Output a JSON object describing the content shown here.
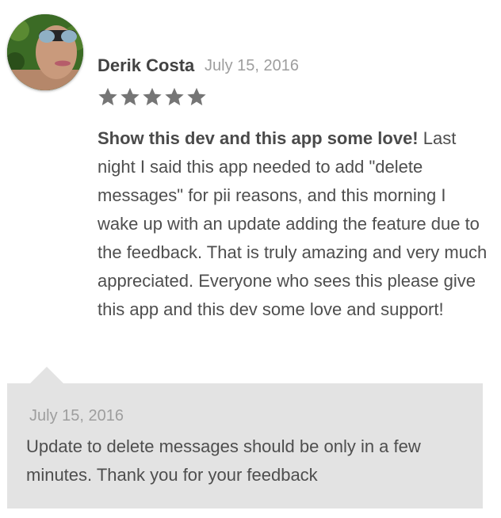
{
  "review": {
    "author": "Derik Costa",
    "date": "July 15, 2016",
    "rating": 5,
    "max_rating": 5,
    "headline": "Show this dev and this app some love!",
    "body": " Last night I said this app needed to add \"delete messages\" for pii reasons, and this morning I wake up with an update adding the feature due to the feedback. That is truly amazing and very much appreciated. Everyone who sees this please give this app and this dev some love and support!"
  },
  "reply": {
    "date": "July 15, 2016",
    "text": "Update to delete messages should be only in a few minutes. Thank you for your feedback"
  },
  "colors": {
    "star": "#757575",
    "reply_background": "#e3e3e3",
    "muted_text": "#9e9e9e"
  }
}
